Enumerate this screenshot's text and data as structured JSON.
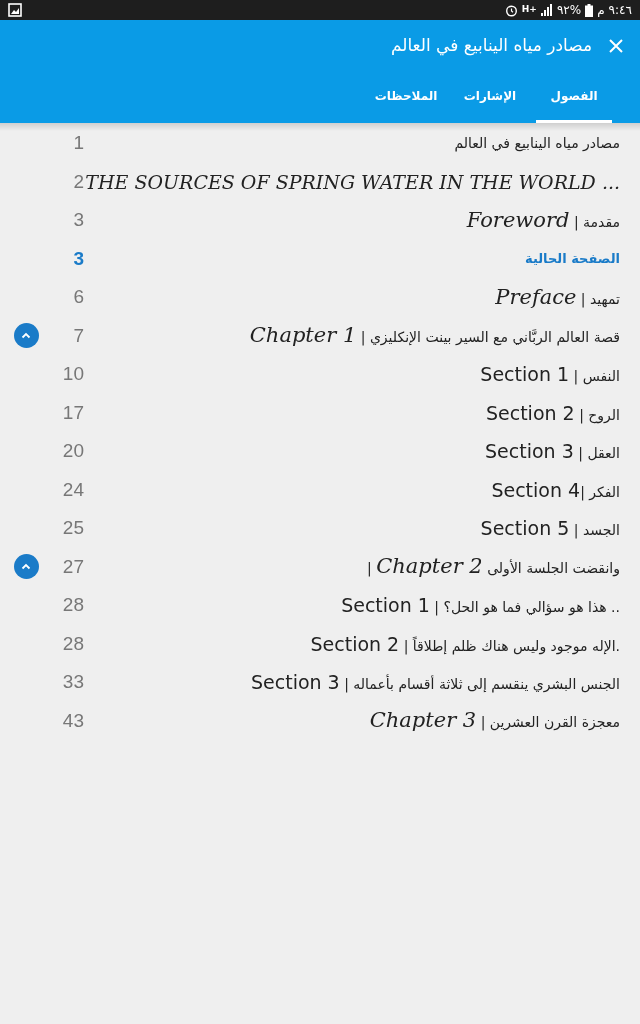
{
  "status_bar": {
    "time": "٩:٤٦",
    "period": "م",
    "battery": "٩٢%",
    "network": "H+"
  },
  "header": {
    "title": "مصادر مياه الينابيع في العالم"
  },
  "tabs": [
    {
      "label": "الفصول",
      "selected": true
    },
    {
      "label": "الإشارات",
      "selected": false
    },
    {
      "label": "الملاحظات",
      "selected": false
    }
  ],
  "toc": [
    {
      "kind": "plain",
      "page": "1",
      "title": "مصادر مياه الينابيع في العالم"
    },
    {
      "kind": "heading",
      "page": "2",
      "title": "THE SOURCES OF SPRING WATER IN THE WORLD ..."
    },
    {
      "kind": "plain",
      "page": "3",
      "title": "مقدمة | *Foreword*"
    },
    {
      "kind": "current",
      "page": "3",
      "title": "الصفحة الحالية"
    },
    {
      "kind": "plain",
      "page": "6",
      "title": "تمهيد | *Preface*"
    },
    {
      "kind": "plain",
      "page": "7",
      "title": "قصة العالم الربَّاني مع السير بينت الإنكليزي | *Chapter 1*",
      "expanded": true
    },
    {
      "kind": "section",
      "page": "10",
      "title": "النفس | Section 1"
    },
    {
      "kind": "section",
      "page": "17",
      "title": "الروح | Section 2"
    },
    {
      "kind": "section",
      "page": "20",
      "title": "العقل | Section 3"
    },
    {
      "kind": "section",
      "page": "24",
      "title": "الفكر |Section 4"
    },
    {
      "kind": "section",
      "page": "25",
      "title": "الجسد | Section 5"
    },
    {
      "kind": "plain",
      "page": "27",
      "title": "وانقضت الجلسة الأولى *Chapter 2* |",
      "expanded": true
    },
    {
      "kind": "section",
      "page": "28",
      "title": ".. هذا هو سؤالي فما هو الحل؟ | Section 1"
    },
    {
      "kind": "section",
      "page": "28",
      "title": ".الإله موجود وليس هناك ظلم إطلاقاً | Section 2"
    },
    {
      "kind": "section",
      "page": "33",
      "title": "الجنس البشري ينقسم إلى ثلاثة أقسام بأعماله | Section 3"
    },
    {
      "kind": "plain",
      "page": "43",
      "title": "معجزة القرن العشرين | *Chapter 3*"
    }
  ]
}
